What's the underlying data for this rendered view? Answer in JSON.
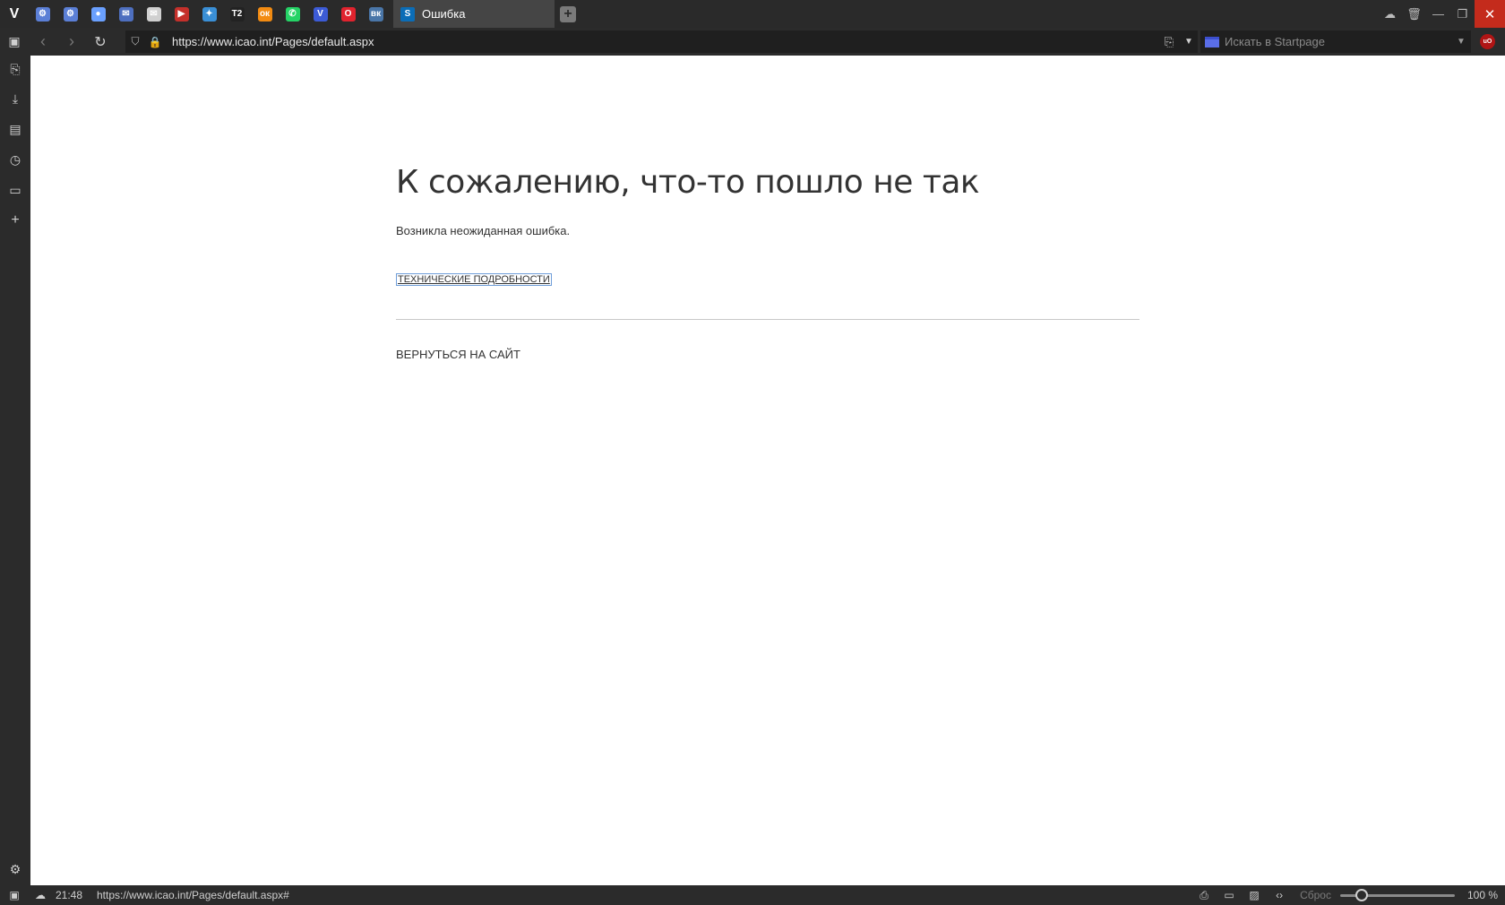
{
  "tabbar": {
    "logo": "V",
    "pinned_tabs": [
      {
        "name": "settings-gear-icon",
        "glyph": "⚙",
        "color": "#5b7fd6"
      },
      {
        "name": "settings-gear-icon",
        "glyph": "⚙",
        "color": "#5b7fd6"
      },
      {
        "name": "drop-icon",
        "glyph": "●",
        "color": "#6aa0ff"
      },
      {
        "name": "mail-icon",
        "glyph": "✉",
        "color": "#4e6fbf"
      },
      {
        "name": "gmail-icon",
        "glyph": "✉",
        "color": "#d0d0d0"
      },
      {
        "name": "youtube-icon",
        "glyph": "▶",
        "color": "#c4302b"
      },
      {
        "name": "twitter-icon",
        "glyph": "✦",
        "color": "#3a8fd6"
      },
      {
        "name": "tele2-icon",
        "glyph": "T2",
        "color": "#222222"
      },
      {
        "name": "odnoklassniki-icon",
        "glyph": "ок",
        "color": "#f28b12"
      },
      {
        "name": "whatsapp-icon",
        "glyph": "✆",
        "color": "#25d366"
      },
      {
        "name": "vivaldi-icon",
        "glyph": "V",
        "color": "#3c5bd6"
      },
      {
        "name": "opera-icon",
        "glyph": "O",
        "color": "#e0232e"
      },
      {
        "name": "vk-icon",
        "glyph": "вк",
        "color": "#4a76a8"
      }
    ],
    "active_tab": {
      "favicon": "S",
      "title": "Ошибка"
    },
    "new_tab": "+"
  },
  "addressbar": {
    "url": "https://www.icao.int/Pages/default.aspx",
    "search_placeholder": "Искать в Startpage",
    "ublock_label": "uO"
  },
  "content": {
    "title": "К сожалению, что-то пошло не так",
    "description": "Возникла неожиданная ошибка.",
    "tech_link": "ТЕХНИЧЕСКИЕ ПОДРОБНОСТИ",
    "back_link": "ВЕРНУТЬСЯ НА САЙТ"
  },
  "statusbar": {
    "time": "21:48",
    "hover_url": "https://www.icao.int/Pages/default.aspx#",
    "reset_label": "Сброс",
    "zoom_label": "100 %",
    "zoom_level": 0.19
  },
  "colors": {
    "chrome_bg": "#2b2b2b",
    "active_tab": "#454545",
    "close_button": "#c42b1c",
    "link_focus": "#6f9ed9"
  }
}
